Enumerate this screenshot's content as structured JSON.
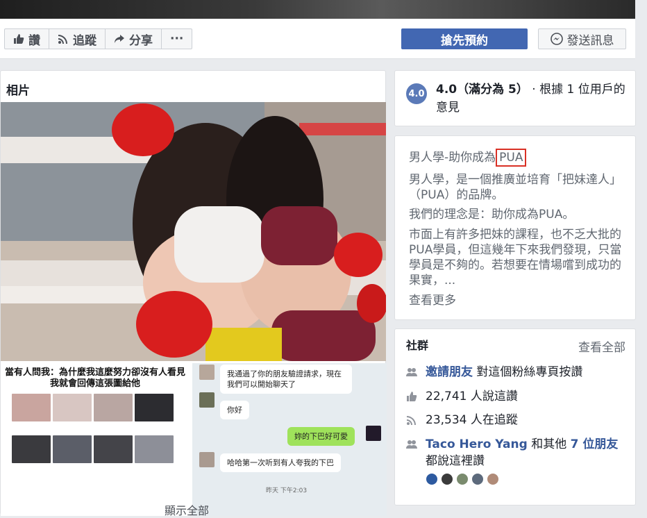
{
  "actions": {
    "like_label": "讚",
    "follow_label": "追蹤",
    "share_label": "分享",
    "more_label": "···",
    "primary_label": "搶先預約",
    "message_label": "發送訊息"
  },
  "photos": {
    "title": "相片",
    "thumb1_headline": "當有人問我：為什麼我這麼努力卻沒有人看見 我就會回傳這張圖給他",
    "chat": {
      "msg1": "我通過了你的朋友驗證請求，現在我們可以開始聊天了",
      "msg2": "你好",
      "msg3": "妳的下巴好可愛",
      "msg4": "哈哈第一次听到有人夸我的下巴",
      "time": "昨天 下午2:03"
    },
    "see_all": "顯示全部"
  },
  "rating": {
    "badge": "4.0",
    "score_text": "4.0（滿分為 5）",
    "suffix_text": "· 根據 1 位用戶的意見"
  },
  "about": {
    "title_prefix": "男人學-助你成為",
    "title_highlight": "PUA",
    "para1": "男人學，是一個推廣並培育「把妹達人」（PUA）的品牌。",
    "para2": "我們的理念是：助你成為PUA。",
    "para3": "市面上有許多把妹的課程，也不乏大批的PUA學員，但這幾年下來我們發現，只當學員是不夠的。若想要在情場嚐到成功的果實，...",
    "see_more": "查看更多"
  },
  "community": {
    "title": "社群",
    "see_all": "查看全部",
    "invite_link": "邀請朋友",
    "invite_text": "對這個粉絲專頁按讚",
    "likes_text": "22,741 人說這讚",
    "follows_text": "23,534 人在追蹤",
    "friend_name": "Taco Hero Yang",
    "friend_mid": "和其他",
    "friend_count": "7 位朋友",
    "friend_tail": "都說這裡讚"
  }
}
